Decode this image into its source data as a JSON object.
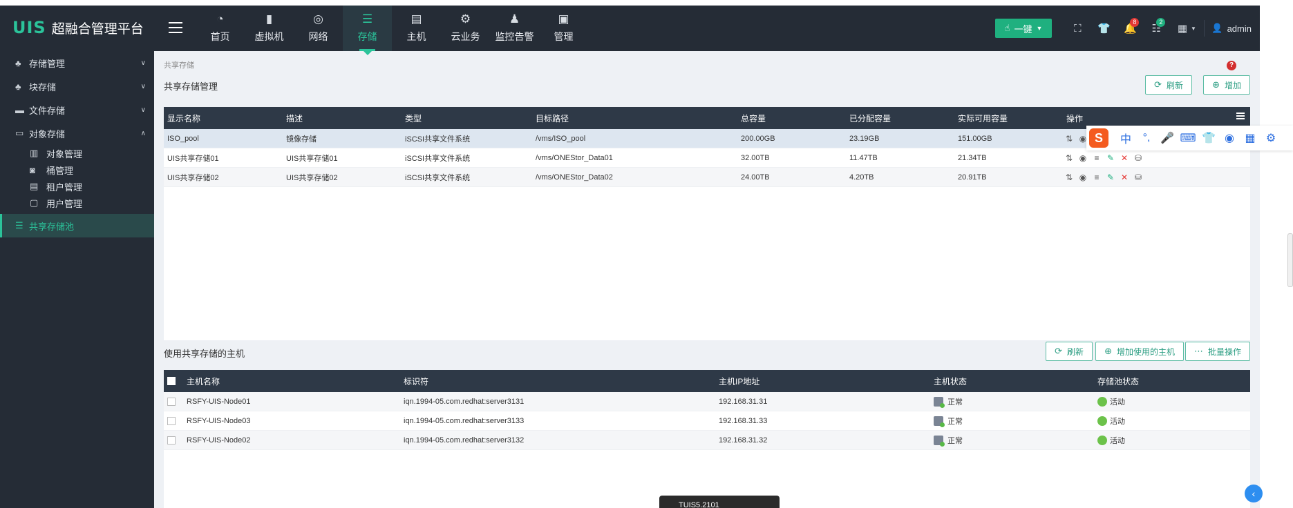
{
  "app": {
    "logo_mark": "UIS",
    "title": "超融合管理平台"
  },
  "nav": [
    {
      "label": "首页",
      "icon": "dashboard-icon",
      "glyph": "◔"
    },
    {
      "label": "虚拟机",
      "icon": "vm-icon",
      "glyph": "▮"
    },
    {
      "label": "网络",
      "icon": "globe-icon",
      "glyph": "◎"
    },
    {
      "label": "存储",
      "icon": "database-icon",
      "glyph": "☰",
      "active": true
    },
    {
      "label": "主机",
      "icon": "server-icon",
      "glyph": "▤"
    },
    {
      "label": "云业务",
      "icon": "gear-icon",
      "glyph": "⚙"
    },
    {
      "label": "监控告警",
      "icon": "bell-alert-icon",
      "glyph": "♟"
    },
    {
      "label": "管理",
      "icon": "monitor-icon",
      "glyph": "▣"
    }
  ],
  "toolbar": {
    "onekey_label": "一键",
    "bell_count": "8",
    "tasks_count": "2",
    "user": "admin"
  },
  "sidebar": {
    "items": [
      {
        "label": "存储管理",
        "expanded": false
      },
      {
        "label": "块存储",
        "expanded": false
      },
      {
        "label": "文件存储",
        "expanded": false
      },
      {
        "label": "对象存储",
        "expanded": true
      }
    ],
    "sub_items": [
      {
        "label": "对象管理"
      },
      {
        "label": "桶管理"
      },
      {
        "label": "租户管理"
      },
      {
        "label": "用户管理"
      }
    ],
    "active_item": "共享存储池"
  },
  "breadcrumb": "共享存储",
  "storage": {
    "title": "共享存储管理",
    "refresh_label": "刷新",
    "add_label": "增加",
    "columns": [
      "显示名称",
      "描述",
      "类型",
      "目标路径",
      "总容量",
      "已分配容量",
      "实际可用容量",
      "操作"
    ],
    "rows": [
      [
        "ISO_pool",
        "镜像存储",
        "iSCSI共享文件系统",
        "/vms/ISO_pool",
        "200.00GB",
        "23.19GB",
        "151.00GB"
      ],
      [
        "UIS共享存储01",
        "UIS共享存储01",
        "iSCSI共享文件系统",
        "/vms/ONEStor_Data01",
        "32.00TB",
        "11.47TB",
        "21.34TB"
      ],
      [
        "UIS共享存储02",
        "UIS共享存储02",
        "iSCSI共享文件系统",
        "/vms/ONEStor_Data02",
        "24.00TB",
        "4.20TB",
        "20.91TB"
      ]
    ]
  },
  "hosts": {
    "title": "使用共享存储的主机",
    "refresh_label": "刷新",
    "add_label": "增加使用的主机",
    "batch_label": "批量操作",
    "columns": [
      "主机名称",
      "标识符",
      "主机IP地址",
      "主机状态",
      "存储池状态"
    ],
    "rows": [
      [
        "RSFY-UIS-Node01",
        "iqn.1994-05.com.redhat:server3131",
        "192.168.31.31",
        "正常",
        "活动"
      ],
      [
        "RSFY-UIS-Node03",
        "iqn.1994-05.com.redhat:server3133",
        "192.168.31.33",
        "正常",
        "活动"
      ],
      [
        "RSFY-UIS-Node02",
        "iqn.1994-05.com.redhat:server3132",
        "192.168.31.32",
        "正常",
        "活动"
      ]
    ]
  },
  "ime": {
    "logo": "S",
    "mode": "中",
    "punct": "°,"
  },
  "taskbar_popup": "TUIS5.2101",
  "colors": {
    "accent": "#2bc39a",
    "topbar": "#252c36",
    "table_header": "#2e3947",
    "selected_row": "#dde6f0"
  }
}
